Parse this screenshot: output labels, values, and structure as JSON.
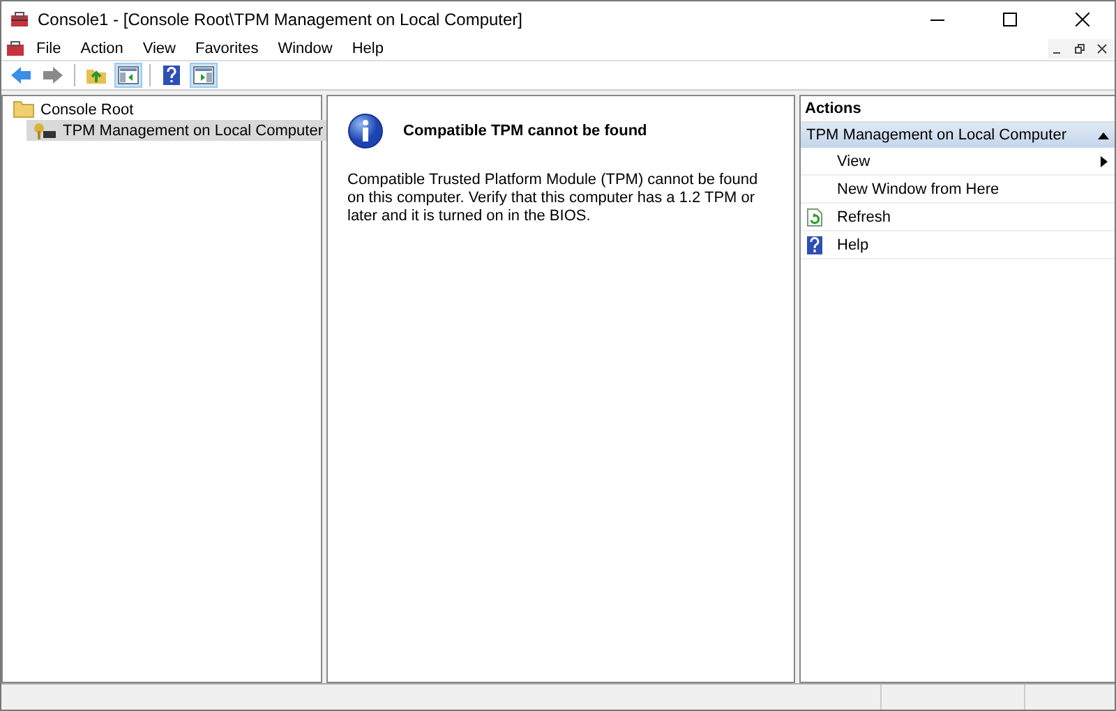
{
  "window": {
    "title": "Console1 - [Console Root\\TPM Management on Local Computer]"
  },
  "menu": [
    "File",
    "Action",
    "View",
    "Favorites",
    "Window",
    "Help"
  ],
  "toolbar": [
    {
      "kind": "back",
      "pressed": false
    },
    {
      "kind": "forward",
      "pressed": false
    },
    {
      "kind": "sep"
    },
    {
      "kind": "up",
      "pressed": false
    },
    {
      "kind": "pane",
      "pressed": true
    },
    {
      "kind": "sep"
    },
    {
      "kind": "help",
      "pressed": false
    },
    {
      "kind": "actionpane",
      "pressed": true
    }
  ],
  "tree": [
    {
      "label": "Console Root",
      "selected": false,
      "children": [
        {
          "label": "TPM Management on Local Computer",
          "selected": true
        }
      ]
    }
  ],
  "message": {
    "title": "Compatible TPM cannot be found",
    "body": "Compatible Trusted Platform Module (TPM) cannot be found on this computer. Verify that this computer has a 1.2 TPM or later and it is turned on in the BIOS."
  },
  "actions": {
    "title": "Actions",
    "section": {
      "label": "TPM Management on Local Computer",
      "expanded": true
    },
    "items": [
      {
        "label": "View",
        "kind": "submenu"
      },
      {
        "label": "New Window from Here",
        "kind": "plain"
      },
      {
        "label": "Refresh",
        "kind": "refresh"
      },
      {
        "label": "Help",
        "kind": "help"
      }
    ]
  }
}
